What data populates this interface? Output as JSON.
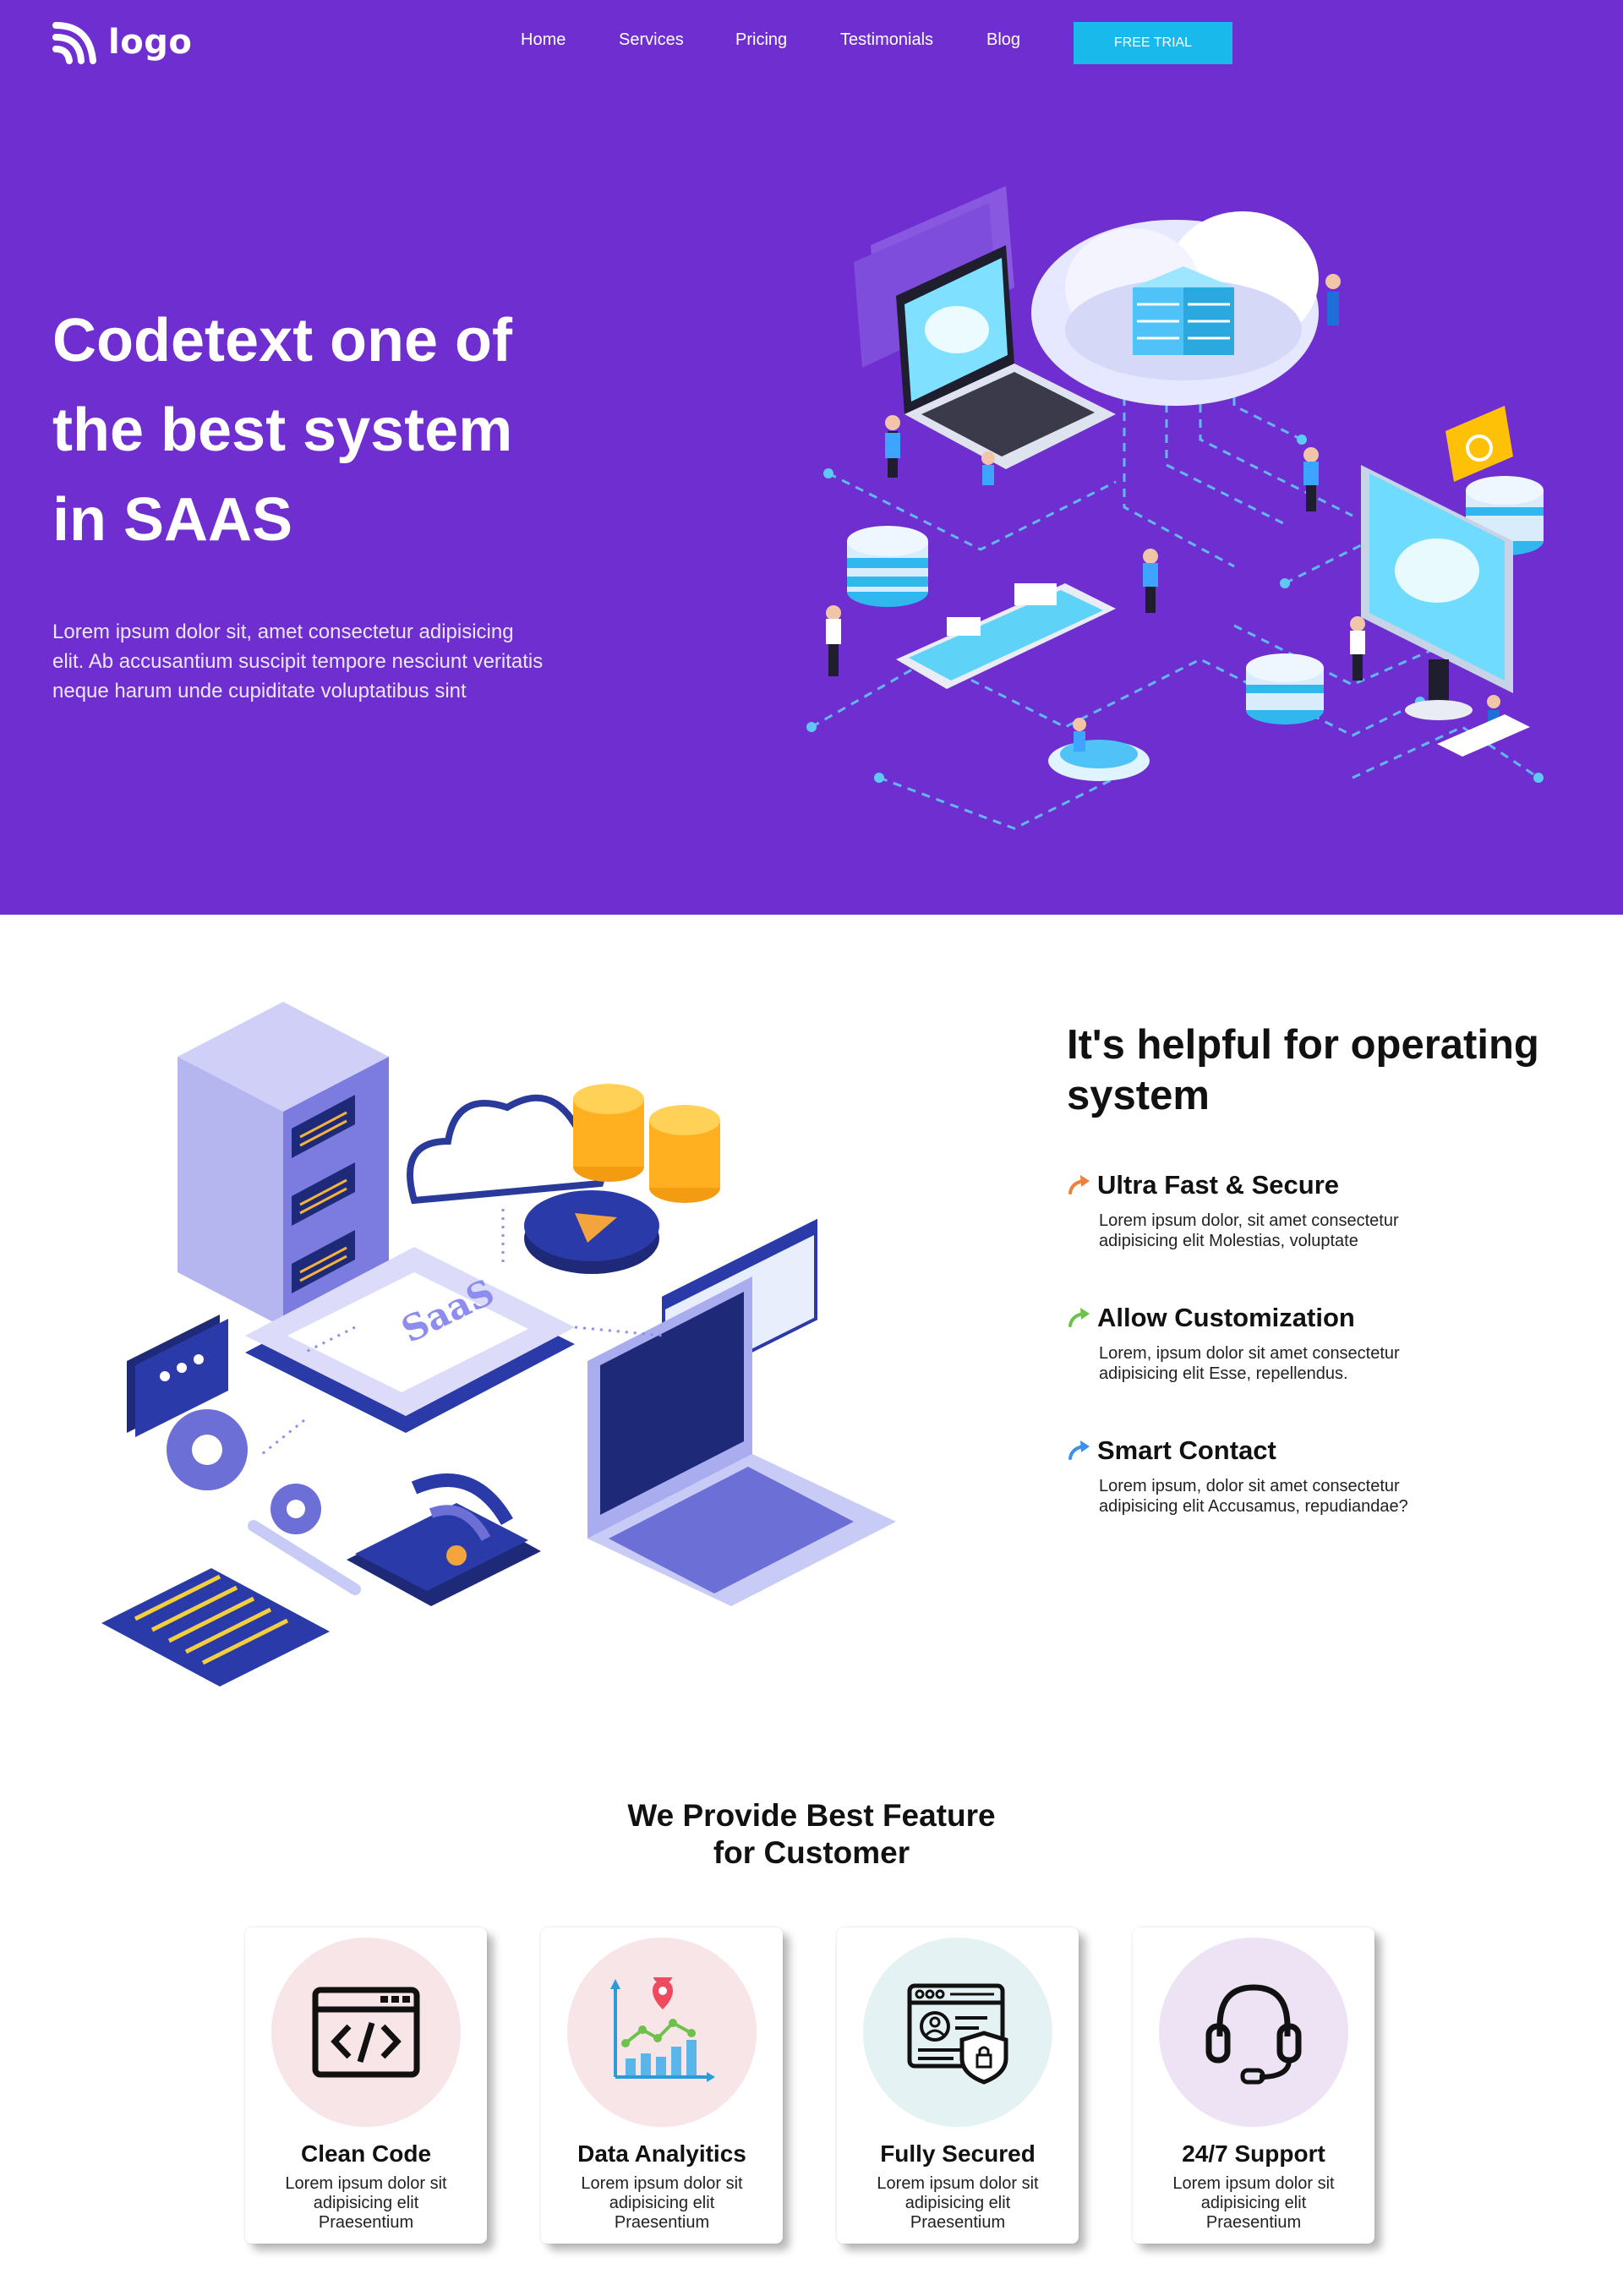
{
  "header": {
    "logo_text": "logo",
    "nav": [
      "Home",
      "Services",
      "Pricing",
      "Testimonials",
      "Blog"
    ],
    "cta_label": "FREE TRIAL"
  },
  "hero": {
    "title_lines": [
      "Codetext one of",
      "the best system",
      "in SAAS"
    ],
    "description_lines": [
      "Lorem ipsum dolor sit, amet consectetur adipisicing",
      "elit. Ab accusantium suscipit tempore nesciunt veritatis",
      "neque harum unde cupiditate voluptatibus sint"
    ]
  },
  "helpful": {
    "title_lines": [
      "It's helpful for operating",
      "system"
    ],
    "illustration_label": "SaaS",
    "features": [
      {
        "title": "Ultra Fast & Secure",
        "desc_lines": [
          "Lorem ipsum dolor, sit amet consectetur",
          "adipisicing elit Molestias, voluptate"
        ],
        "icon": "arrow-icon",
        "color": "#f07f3b"
      },
      {
        "title": "Allow Customization",
        "desc_lines": [
          "Lorem, ipsum dolor sit amet consectetur",
          "adipisicing elit Esse, repellendus."
        ],
        "icon": "arrow-icon",
        "color": "#6cc24a"
      },
      {
        "title": "Smart Contact",
        "desc_lines": [
          "Lorem ipsum, dolor sit amet consectetur",
          "adipisicing elit Accusamus, repudiandae?"
        ],
        "icon": "arrow-icon",
        "color": "#3b8ff0"
      }
    ]
  },
  "best": {
    "title_lines": [
      "We Provide Best Feature",
      "for Customer"
    ],
    "cards": [
      {
        "title": "Clean Code",
        "desc_lines": [
          "Lorem ipsum dolor sit",
          "adipisicing elit",
          "Praesentium"
        ],
        "icon": "code-icon",
        "circle_color": "#f8e5e7"
      },
      {
        "title": "Data Analyitics",
        "desc_lines": [
          "Lorem ipsum dolor sit",
          "adipisicing elit",
          "Praesentium"
        ],
        "icon": "analytics-icon",
        "circle_color": "#f8e5e7"
      },
      {
        "title": "Fully Secured",
        "desc_lines": [
          "Lorem ipsum dolor sit",
          "adipisicing elit",
          "Praesentium"
        ],
        "icon": "security-shield-icon",
        "circle_color": "#e5f2f4"
      },
      {
        "title": "24/7 Support",
        "desc_lines": [
          "Lorem ipsum dolor sit",
          "adipisicing elit",
          "Praesentium"
        ],
        "icon": "headset-icon",
        "circle_color": "#ede3f5"
      }
    ]
  },
  "colors": {
    "hero_bg": "#6f2fd0",
    "cta_bg": "#19b9ec"
  }
}
